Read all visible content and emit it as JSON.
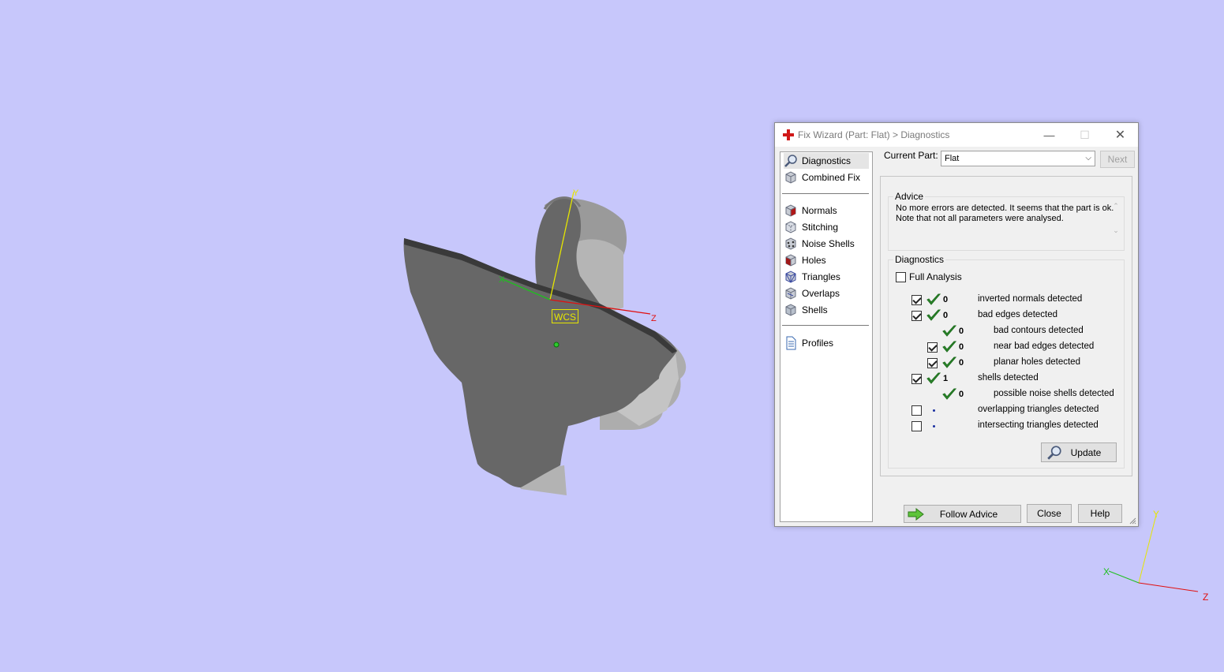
{
  "viewport": {
    "wcs_label": "WCS",
    "axes_main": {
      "x": "X",
      "y": "Y",
      "z": "Z"
    },
    "axes_corner": {
      "x": "X",
      "y": "Y",
      "z": "Z"
    },
    "colors": {
      "x": "#1fbf1f",
      "y": "#e6e600",
      "z": "#e01010",
      "background": "#c7c7fb",
      "model": "#676767"
    }
  },
  "dialog": {
    "title": "Fix Wizard (Part: Flat) > Diagnostics",
    "nav": {
      "group1": [
        "Diagnostics",
        "Combined Fix"
      ],
      "group2": [
        "Normals",
        "Stitching",
        "Noise Shells",
        "Holes",
        "Triangles",
        "Overlaps",
        "Shells"
      ],
      "group3": [
        "Profiles"
      ],
      "selected": "Diagnostics"
    },
    "current_part_label": "Current Part:",
    "current_part_value": "Flat",
    "next_label": "Next",
    "advice": {
      "title": "Advice",
      "text": "No more errors are detected. It seems that the part is ok. Note that not all parameters were analysed."
    },
    "diagnostics": {
      "title": "Diagnostics",
      "full_analysis_label": "Full Analysis",
      "full_analysis_checked": false,
      "rows": [
        {
          "label": "inverted normals detected",
          "count": "0",
          "checked": true,
          "has_checkbox": true,
          "indent": 0,
          "status": "ok"
        },
        {
          "label": "bad edges detected",
          "count": "0",
          "checked": true,
          "has_checkbox": true,
          "indent": 0,
          "status": "ok"
        },
        {
          "label": "bad contours detected",
          "count": "0",
          "checked": false,
          "has_checkbox": false,
          "indent": 1,
          "status": "ok"
        },
        {
          "label": "near bad edges detected",
          "count": "0",
          "checked": true,
          "has_checkbox": true,
          "indent": 1,
          "status": "ok"
        },
        {
          "label": "planar holes detected",
          "count": "0",
          "checked": true,
          "has_checkbox": true,
          "indent": 1,
          "status": "ok"
        },
        {
          "label": "shells detected",
          "count": "1",
          "checked": true,
          "has_checkbox": true,
          "indent": 0,
          "status": "ok"
        },
        {
          "label": "possible noise shells detected",
          "count": "0",
          "checked": false,
          "has_checkbox": false,
          "indent": 1,
          "status": "ok"
        },
        {
          "label": "overlapping triangles detected",
          "count": "",
          "checked": false,
          "has_checkbox": true,
          "indent": 0,
          "status": "pending"
        },
        {
          "label": "intersecting triangles detected",
          "count": "",
          "checked": false,
          "has_checkbox": true,
          "indent": 0,
          "status": "pending"
        }
      ],
      "update_label": "Update"
    },
    "buttons": {
      "follow_advice": "Follow Advice",
      "close": "Close",
      "help": "Help"
    }
  }
}
